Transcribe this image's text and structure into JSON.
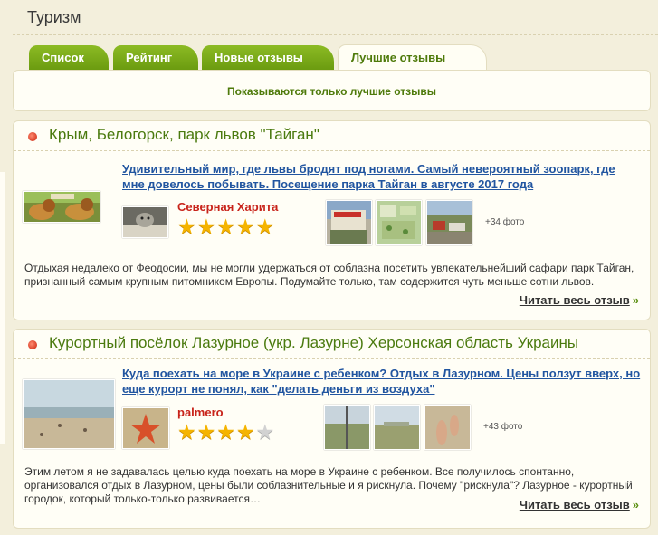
{
  "page": {
    "title": "Туризм"
  },
  "tabs": [
    {
      "label": "Список"
    },
    {
      "label": "Рейтинг"
    },
    {
      "label": "Новые отзывы"
    },
    {
      "label": "Лучшие отзывы",
      "active": true
    }
  ],
  "notice": "Показываются только лучшие отзывы",
  "reviews": [
    {
      "place": "Крым, Белогорск, парк львов \"Тайган\"",
      "headline": "Удивительный мир, где львы бродят под ногами. Самый невероятный зоопарк, где мне довелось побывать. Посещение парка Тайган в августе 2017 года",
      "author": "Северная Харита",
      "rating": 5,
      "rating_max": 5,
      "more_photos": "+34 фото",
      "excerpt": "Отдыхая недалеко от Феодосии, мы не могли удержаться от соблазна посетить увлекательнейший сафари парк Тайган, признанный самым крупным питомником Европы. Подумайте только, там содержится чуть меньше сотни львов.",
      "read_more": "Читать весь отзыв"
    },
    {
      "place": "Курортный посёлок Лазурное (укр. Лазурне) Херсонская область Украины",
      "headline": "Куда поехать на море в Украине с ребенком? Отдых в Лазурном. Цены ползут вверх, но еще курорт не понял, как \"делать деньги из воздуха\"",
      "author": "palmero",
      "rating": 4,
      "rating_max": 5,
      "more_photos": "+43 фото",
      "excerpt": "Этим летом я не задавалась целью куда поехать на море в Украине с ребенком. Все получилось спонтанно, организовался отдых в Лазурном, цены были соблазнительные и я рискнула. Почему \"рискнула\"? Лазурное - курортный городок, который только-только развивается…",
      "read_more": "Читать весь отзыв"
    }
  ],
  "colors": {
    "accent": "#6a9a0f",
    "link": "#2155a0",
    "author": "#c8231a",
    "star": "#f5b400"
  }
}
